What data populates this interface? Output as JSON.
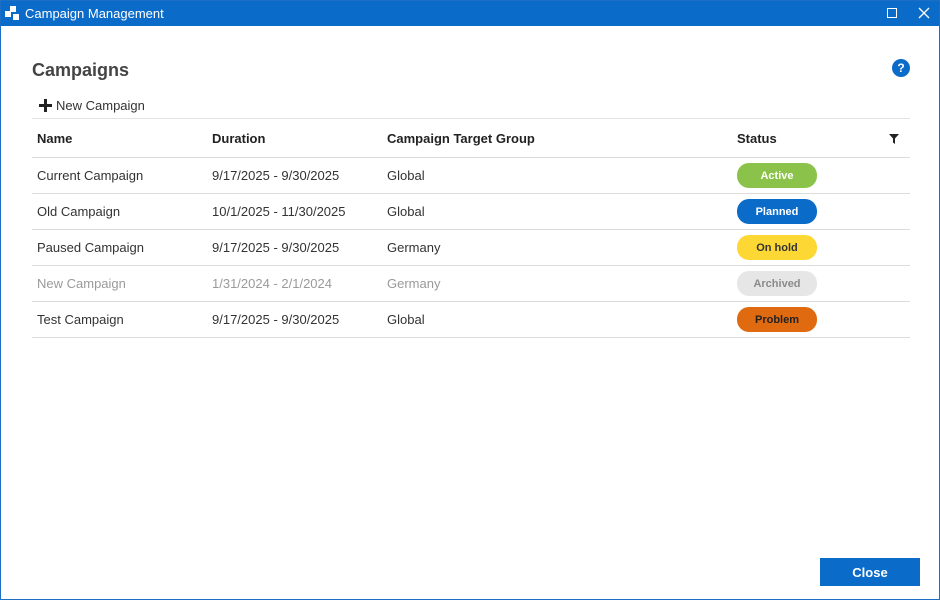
{
  "window": {
    "title": "Campaign Management",
    "app_icon": "app-logo-icon",
    "controls": [
      "maximize-icon",
      "close-icon"
    ]
  },
  "page": {
    "title": "Campaigns",
    "help_label": "?"
  },
  "toolbar": {
    "new_campaign_label": "New Campaign",
    "new_icon": "plus-icon"
  },
  "table": {
    "columns": {
      "name": "Name",
      "duration": "Duration",
      "target_group": "Campaign Target Group",
      "status": "Status"
    },
    "filter_icon": "filter-icon",
    "rows": [
      {
        "name": "Current Campaign",
        "duration": "9/17/2025 - 9/30/2025",
        "target_group": "Global",
        "status": "Active"
      },
      {
        "name": "Old Campaign",
        "duration": "10/1/2025 - 11/30/2025",
        "target_group": "Global",
        "status": "Planned"
      },
      {
        "name": "Paused Campaign",
        "duration": "9/17/2025 - 9/30/2025",
        "target_group": "Germany",
        "status": "On hold"
      },
      {
        "name": "New Campaign",
        "duration": "1/31/2024 - 2/1/2024",
        "target_group": "Germany",
        "status": "Archived"
      },
      {
        "name": "Test Campaign",
        "duration": "9/17/2025 - 9/30/2025",
        "target_group": "Global",
        "status": "Problem"
      }
    ]
  },
  "status_colors": {
    "Active": {
      "bg": "#8bc34a",
      "fg": "#ffffff"
    },
    "Planned": {
      "bg": "#0b6bc8",
      "fg": "#ffffff"
    },
    "On hold": {
      "bg": "#fdd835",
      "fg": "#333333"
    },
    "Archived": {
      "bg": "#e6e6e6",
      "fg": "#8a8a8a"
    },
    "Problem": {
      "bg": "#e06a10",
      "fg": "#222222"
    }
  },
  "colors": {
    "accent": "#0b6bc8",
    "row_divider": "#dcdcdc",
    "archived_text": "#9a9a9a"
  },
  "footer": {
    "close_label": "Close"
  }
}
